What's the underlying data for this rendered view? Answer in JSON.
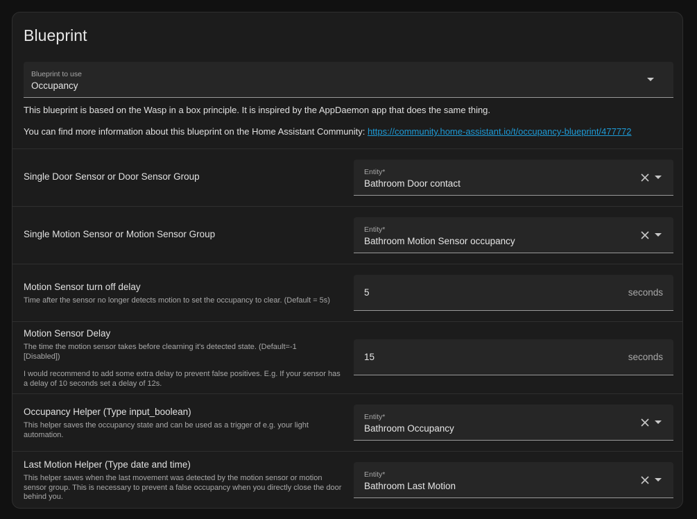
{
  "card": {
    "title": "Blueprint"
  },
  "blueprint_select": {
    "label": "Blueprint to use",
    "value": "Occupancy"
  },
  "description": {
    "line1": "This blueprint is based on the Wasp in a box principle. It is inspired by the AppDaemon app that does the same thing.",
    "line2_prefix": "You can find more information about this blueprint on the Home Assistant Community: ",
    "line2_link": "https://community.home-assistant.io/t/occupancy-blueprint/477772"
  },
  "rows": {
    "door": {
      "title": "Single Door Sensor or Door Sensor Group",
      "field_label": "Entity*",
      "value": "Bathroom Door contact"
    },
    "motion": {
      "title": "Single Motion Sensor or Motion Sensor Group",
      "field_label": "Entity*",
      "value": "Bathroom Motion Sensor occupancy"
    },
    "turn_off_delay": {
      "title": "Motion Sensor turn off delay",
      "desc": "Time after the sensor no longer detects motion to set the occupancy to clear. (Default = 5s)",
      "value": "5",
      "unit": "seconds"
    },
    "motion_delay": {
      "title": "Motion Sensor Delay",
      "desc1": "The time the motion sensor takes before clearning it's detected state. (Default=-1 [Disabled])",
      "desc2": "I would recommend to add some extra delay to prevent false positives. E.g. If your sensor has a delay of 10 seconds set a delay of 12s.",
      "value": "15",
      "unit": "seconds"
    },
    "occupancy_helper": {
      "title": "Occupancy Helper (Type input_boolean)",
      "desc": "This helper saves the occupancy state and can be used as a trigger of e.g. your light automation.",
      "field_label": "Entity*",
      "value": "Bathroom Occupancy"
    },
    "last_motion_helper": {
      "title": "Last Motion Helper (Type date and time)",
      "desc": "This helper saves when the last movement was detected by the motion sensor or motion sensor group. This is necessary to prevent a false occupancy when you directly close the door behind you.",
      "field_label": "Entity*",
      "value": "Bathroom Last Motion"
    }
  },
  "icons": {
    "clear": "close-icon",
    "dropdown": "chevron-down-icon"
  }
}
